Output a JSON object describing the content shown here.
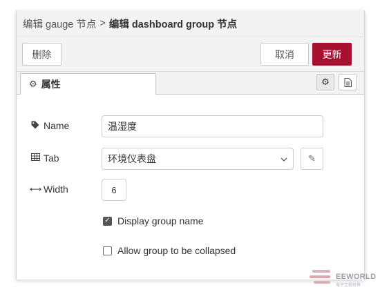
{
  "title": {
    "crumb": "编辑 gauge 节点",
    "separator": ">",
    "current": "编辑 dashboard group 节点"
  },
  "toolbar": {
    "delete_label": "删除",
    "cancel_label": "取消",
    "update_label": "更新"
  },
  "tabs": {
    "properties_label": "属性",
    "settings_icon": "gear-icon",
    "info_icon": "document-icon"
  },
  "form": {
    "name_label": "Name",
    "name_value": "温湿度",
    "tab_label": "Tab",
    "tab_value": "环境仪表盘",
    "width_label": "Width",
    "width_value": "6",
    "display_group_name_label": "Display group name",
    "display_group_name_checked": true,
    "allow_collapse_label": "Allow group to be collapsed",
    "allow_collapse_checked": false
  },
  "watermark": {
    "brand": "EEWORLD",
    "sub": "电子工程世界"
  },
  "colors": {
    "accent": "#a8102f",
    "chrome": "#f3f3f3"
  }
}
